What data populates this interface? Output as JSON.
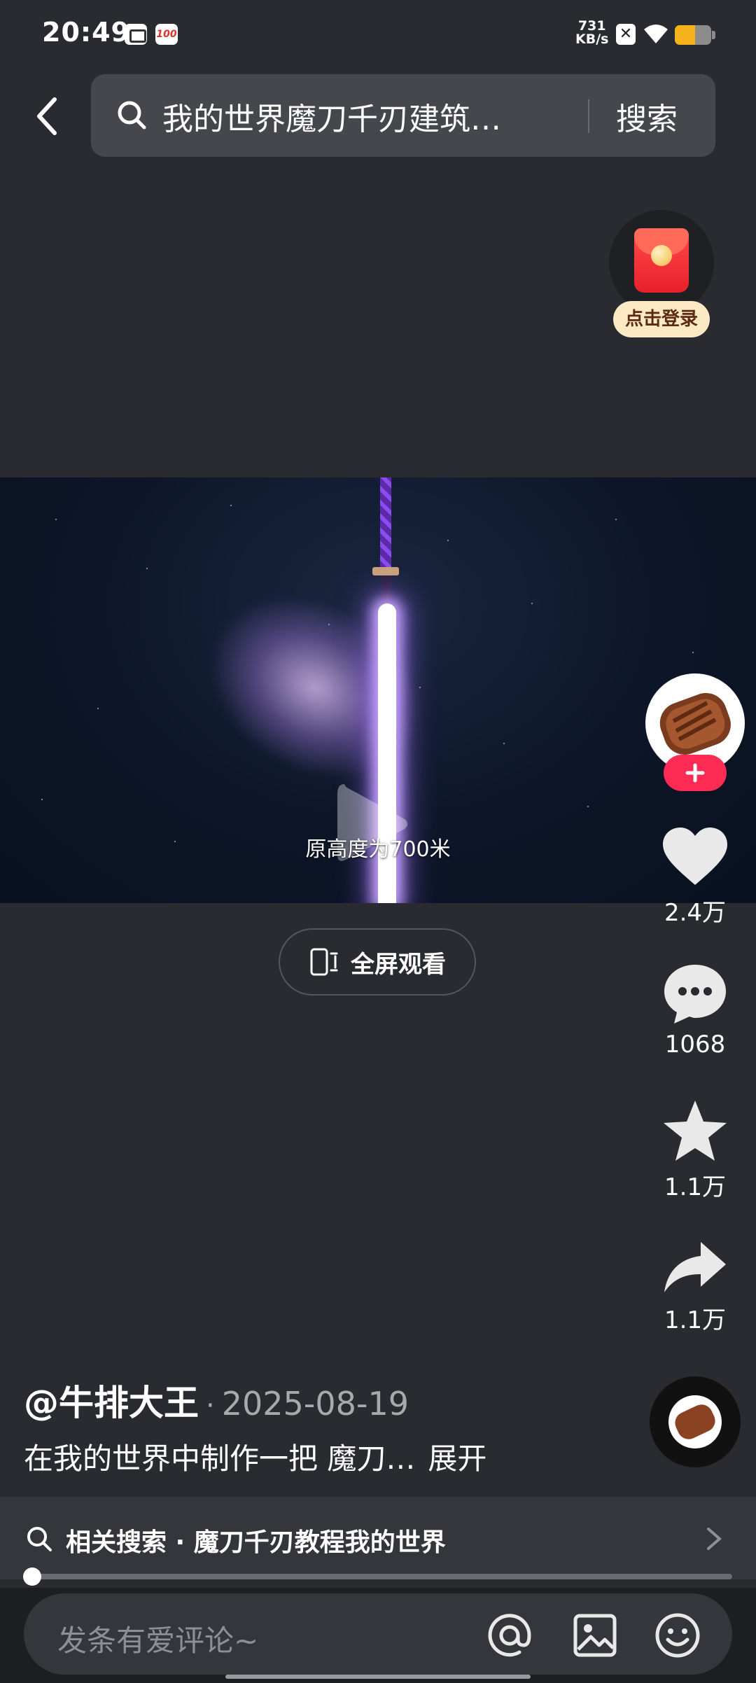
{
  "status_bar": {
    "time": "20:49",
    "app_badge": "100",
    "net_speed_value": "731",
    "net_speed_unit": "KB/s",
    "sim_icon": "✕",
    "battery_level": 0.55
  },
  "header": {
    "search_query": "我的世界魔刀千刃建筑…",
    "search_button": "搜索"
  },
  "reward": {
    "label": "点击登录"
  },
  "video": {
    "caption": "原高度为700米"
  },
  "fullscreen": {
    "label": "全屏观看"
  },
  "actions": {
    "likes": "2.4万",
    "comments": "1068",
    "favorites": "1.1万",
    "shares": "1.1万"
  },
  "post": {
    "author": "@牛排大王",
    "date": "2025-08-19",
    "dot": "·",
    "description": "在我的世界中制作一把 魔刀…",
    "expand_label": "展开"
  },
  "related": {
    "text": "相关搜索 · 魔刀千刃教程我的世界"
  },
  "playback": {
    "progress": 0.012
  },
  "comment_bar": {
    "placeholder": "发条有爱评论~"
  },
  "colors": {
    "background": "#2a2b30",
    "follow_accent": "#fe2c55",
    "battery": "#f6b21b"
  },
  "icons": [
    "back-icon",
    "search-icon",
    "heart-icon",
    "comment-icon",
    "star-icon",
    "share-icon",
    "at-icon",
    "image-icon",
    "emoji-icon",
    "fullscreen-icon",
    "play-icon",
    "chevron-right-icon"
  ]
}
